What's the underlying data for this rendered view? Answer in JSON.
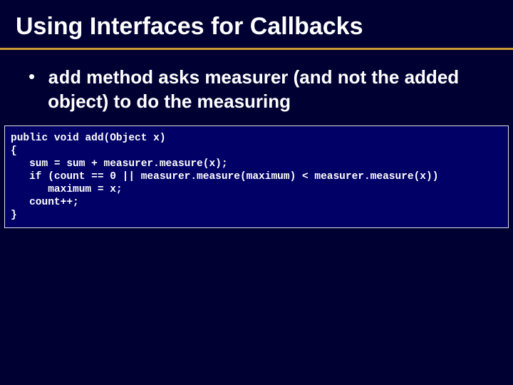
{
  "slide": {
    "title": "Using Interfaces for Callbacks",
    "bullet1_code": "add",
    "bullet1_rest": " method asks measurer (and not the added object) to do the measuring",
    "code": "public void add(Object x)\n{\n   sum = sum + measurer.measure(x);\n   if (count == 0 || measurer.measure(maximum) < measurer.measure(x))\n      maximum = x;\n   count++;\n}"
  }
}
